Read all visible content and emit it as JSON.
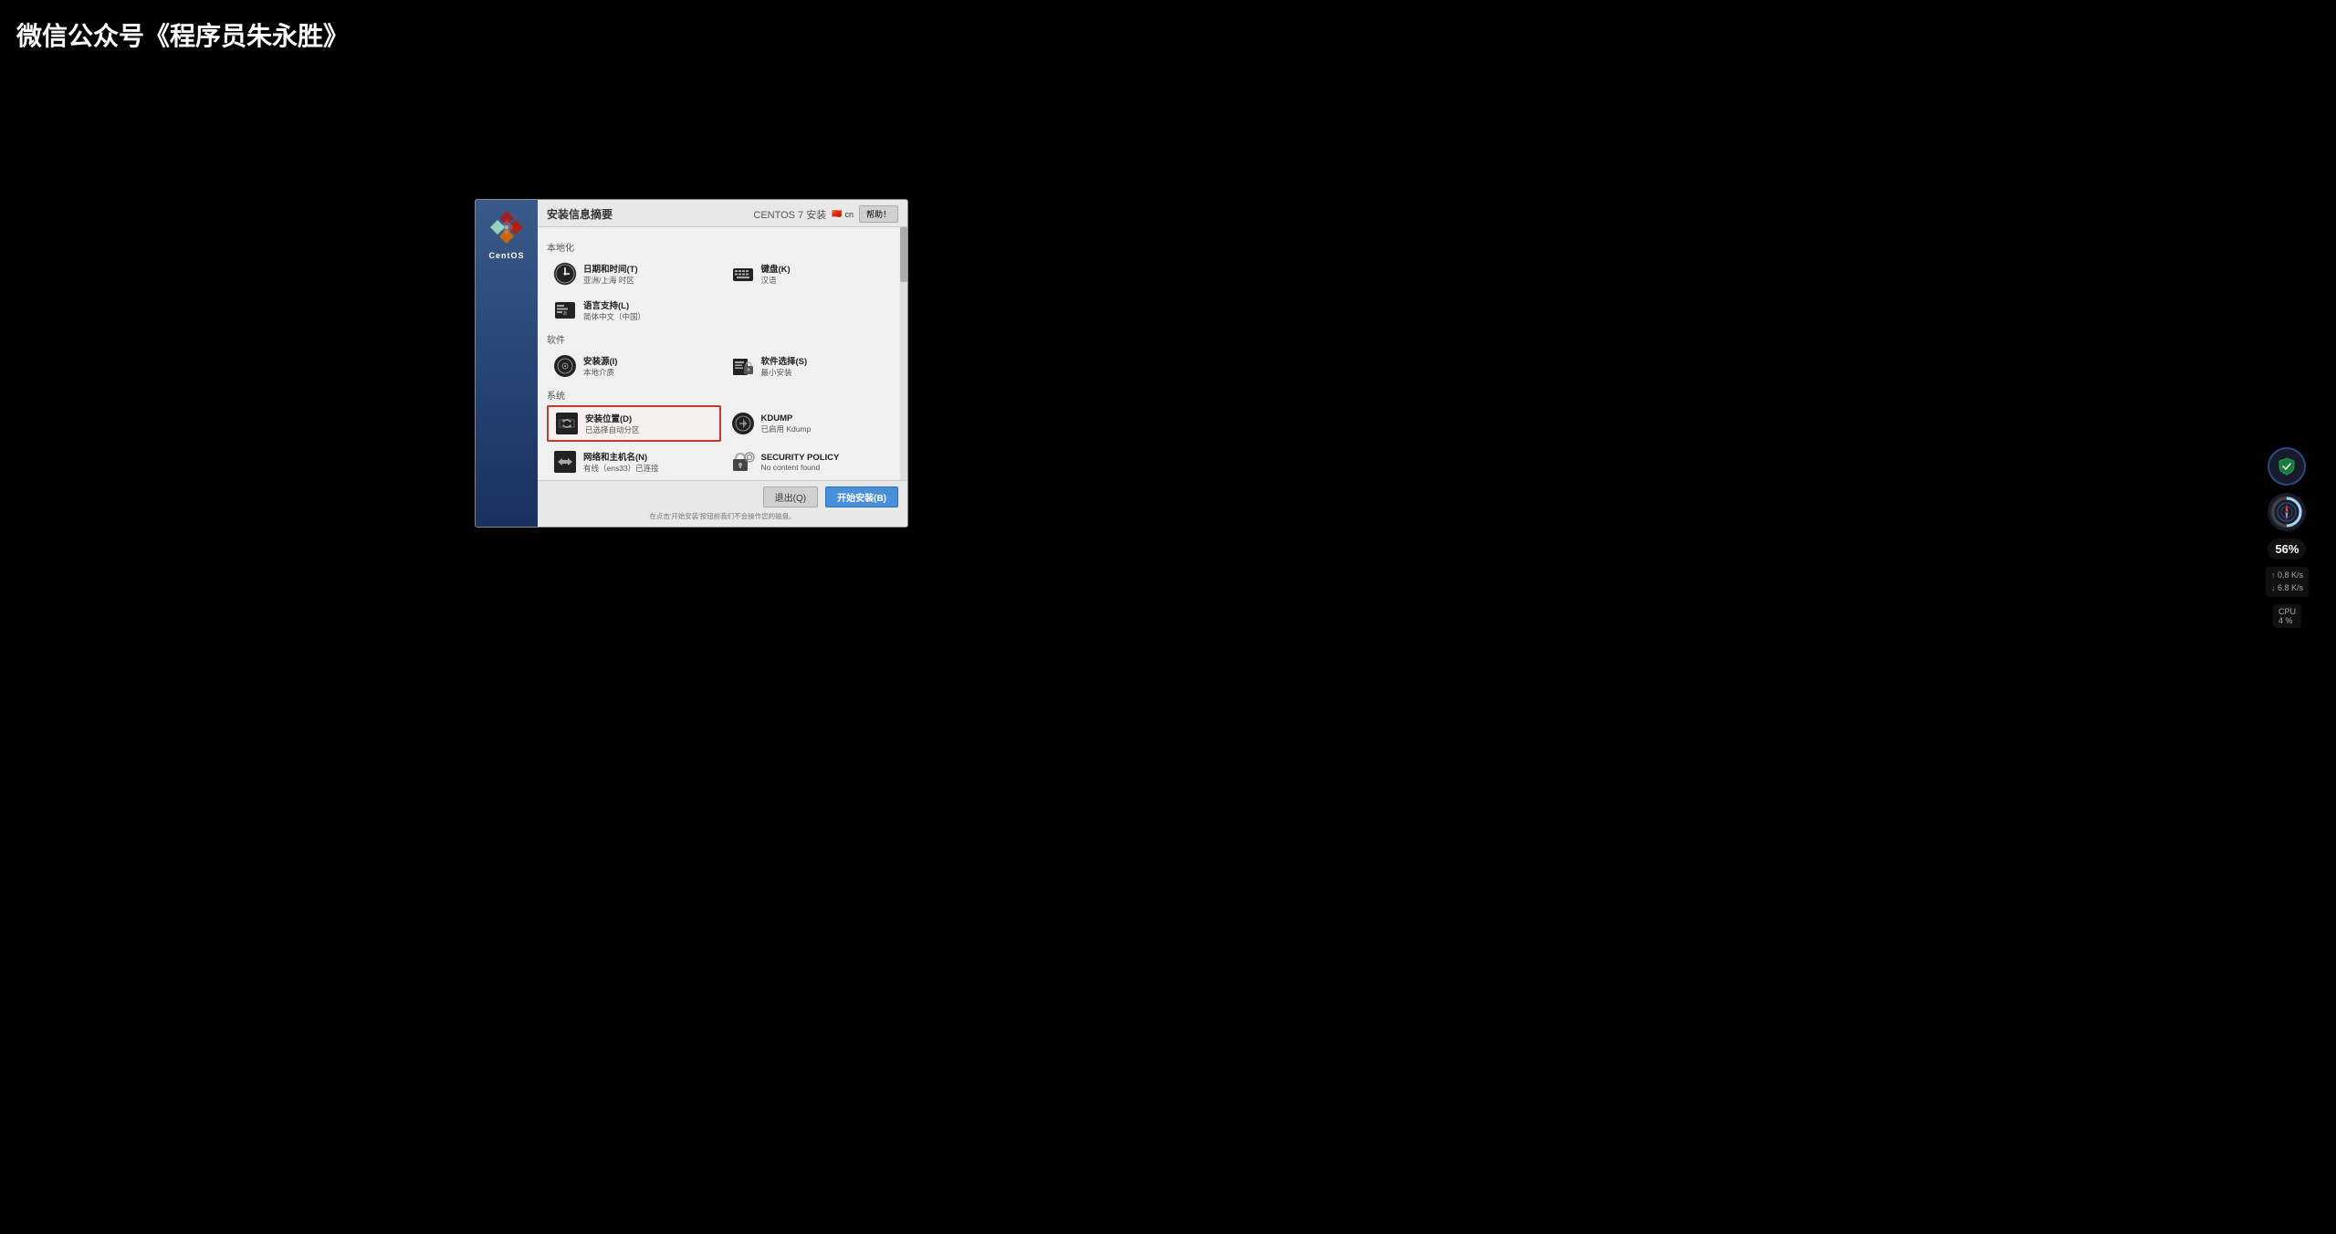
{
  "watermark": {
    "text": "微信公众号《程序员朱永胜》"
  },
  "window": {
    "install_title": "安装信息摘要",
    "centos_version": "CENTOS 7 安装",
    "lang_code": "cn",
    "help_button": "帮助！",
    "centos_logo_text": "CentOS"
  },
  "sections": {
    "localization": {
      "header": "本地化",
      "items": [
        {
          "id": "datetime",
          "title": "日期和时间(T)",
          "subtitle": "亚洲/上海 时区"
        },
        {
          "id": "keyboard",
          "title": "键盘(K)",
          "subtitle": "汉语"
        },
        {
          "id": "language",
          "title": "语言支持(L)",
          "subtitle": "简体中文（中国）"
        }
      ]
    },
    "software": {
      "header": "软件",
      "items": [
        {
          "id": "install_source",
          "title": "安装源(I)",
          "subtitle": "本地介质"
        },
        {
          "id": "software_selection",
          "title": "软件选择(S)",
          "subtitle": "最小安装"
        }
      ]
    },
    "system": {
      "header": "系统",
      "items": [
        {
          "id": "install_destination",
          "title": "安装位置(D)",
          "subtitle": "已选择自动分区",
          "highlighted": true
        },
        {
          "id": "kdump",
          "title": "KDUMP",
          "subtitle": "已启用 Kdump"
        },
        {
          "id": "network",
          "title": "网络和主机名(N)",
          "subtitle": "有线（ens33）已连接"
        },
        {
          "id": "security_policy",
          "title": "SECURITY POLICY",
          "subtitle": "No content found"
        }
      ]
    }
  },
  "buttons": {
    "quit": "退出(Q)",
    "start_install": "开始安装(B)"
  },
  "bottom_note": "在点击'开始安装'按钮前我们不会操作您的磁盘。",
  "tray": {
    "percent": "56%",
    "upload_speed": "0.8",
    "upload_unit": "K/s",
    "download_speed": "6.8",
    "download_unit": "K/s",
    "cpu_label": "CPU",
    "cpu_percent": "4",
    "cpu_unit": "%"
  }
}
